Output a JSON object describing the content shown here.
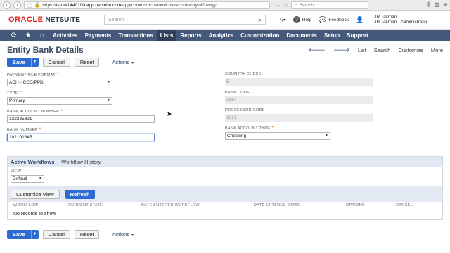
{
  "browser": {
    "url_prefix": "https://",
    "url_host": "tstdrv1440100.app.netsuite.com",
    "url_path": "/app/common/custom/custrecordentry.nl?rectyp",
    "search_placeholder": "Search"
  },
  "header": {
    "logo_oracle": "ORACLE",
    "logo_netsuite": "NETSUITE",
    "search_placeholder": "Search",
    "help_label": "Help",
    "feedback_label": "Feedback",
    "user_name": "JR Tallman",
    "user_role": "JR Tallman - Administrator"
  },
  "nav": {
    "items": [
      "Activities",
      "Payments",
      "Transactions",
      "Lists",
      "Reports",
      "Analytics",
      "Customization",
      "Documents",
      "Setup",
      "Support"
    ],
    "active": "Lists"
  },
  "page": {
    "title": "Entity Bank Details",
    "record_nav": {
      "list": "List",
      "search": "Search",
      "customize": "Customize",
      "more": "More"
    },
    "buttons": {
      "save": "Save",
      "cancel": "Cancel",
      "reset": "Reset",
      "actions": "Actions"
    }
  },
  "form": {
    "payment_file_format": {
      "label": "PAYMENT FILE FORMAT",
      "value": "ACH - CCD/PPD"
    },
    "type": {
      "label": "TYPE",
      "value": "Primary"
    },
    "bank_account_number": {
      "label": "BANK ACCOUNT NUMBER",
      "value": "122235821"
    },
    "bank_number": {
      "label": "BANK NUMBER",
      "value": "102101645"
    },
    "country_check": {
      "label": "COUNTRY CHECK",
      "value": "5"
    },
    "bank_code": {
      "label": "BANK CODE",
      "value": "0164"
    },
    "processor_code": {
      "label": "PROCESSOR CODE",
      "value": "1021"
    },
    "bank_account_type": {
      "label": "BANK ACCOUNT TYPE",
      "value": "Checking"
    }
  },
  "workflows": {
    "tabs": [
      "Active Workflows",
      "Workflow History"
    ],
    "view_label": "VIEW",
    "view_value": "Default",
    "customize_view": "Customize View",
    "refresh": "Refresh",
    "columns": [
      "WORKFLOW",
      "CURRENT STATE",
      "DATE ENTERED WORKFLOW",
      "DATE ENTERED STATE",
      "OPTIONS",
      "CANCEL"
    ],
    "empty_text": "No records to show."
  }
}
